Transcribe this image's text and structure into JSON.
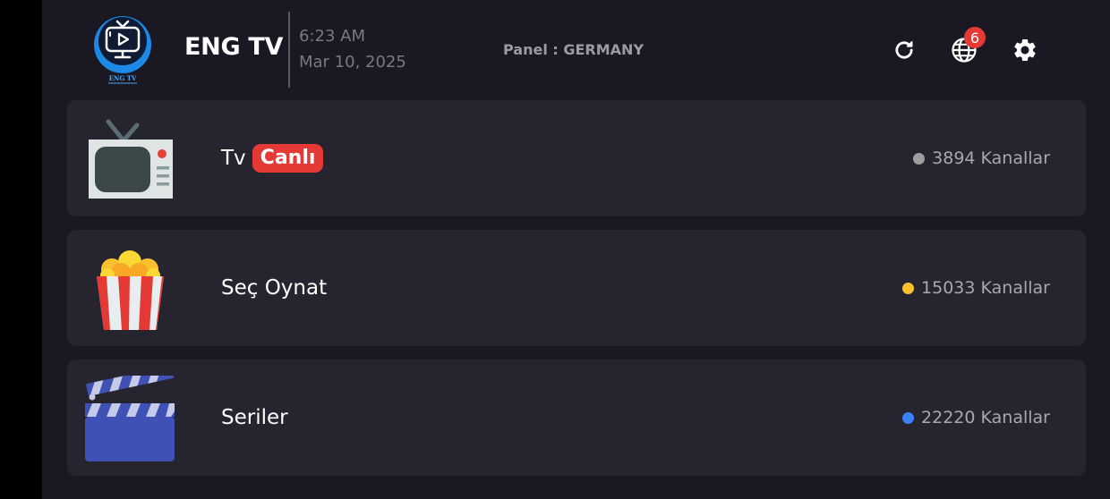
{
  "header": {
    "app_title": "ENG TV",
    "logo_text": "ENG TV",
    "time": "6:23 AM",
    "date": "Mar 10, 2025",
    "panel": "Panel : GERMANY",
    "notification_count": "6",
    "icons": [
      "refresh-icon",
      "globe-icon",
      "settings-icon"
    ]
  },
  "categories": [
    {
      "label": "Tv",
      "badge": "Canlı",
      "count_text": "3894 Kanallar",
      "dot_color": "#9e9e9e",
      "icon": "tv-icon"
    },
    {
      "label": "Seç Oynat",
      "count_text": "15033 Kanallar",
      "dot_color": "#fbc02d",
      "icon": "popcorn-icon"
    },
    {
      "label": "Seriler",
      "count_text": "22220 Kanallar",
      "dot_color": "#3b82f6",
      "icon": "clapperboard-icon"
    }
  ],
  "colors": {
    "background": "#1a1823",
    "card": "#26242f",
    "live_badge": "#e53935",
    "accent_blue": "#1e88e5"
  }
}
